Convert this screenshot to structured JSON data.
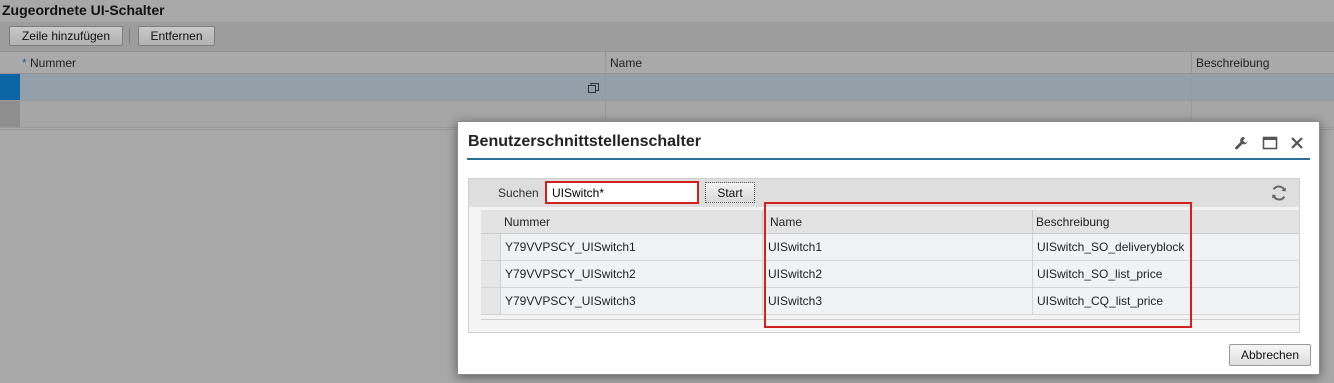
{
  "page": {
    "title": "Zugeordnete UI-Schalter",
    "toolbar": {
      "add_row": "Zeile hinzufügen",
      "remove": "Entfernen"
    },
    "table": {
      "required_marker": "*",
      "columns": [
        "Nummer",
        "Name",
        "Beschreibung"
      ]
    }
  },
  "dialog": {
    "title": "Benutzerschnittstellenschalter",
    "tools": [
      "wrench-icon",
      "maximize-icon",
      "close-icon"
    ],
    "search": {
      "label": "Suchen",
      "value": "UISwitch*",
      "button": "Start"
    },
    "results": {
      "columns": [
        "Nummer",
        "Name",
        "Beschreibung"
      ],
      "rows": [
        {
          "nummer": "Y79VVPSCY_UISwitch1",
          "name": "UISwitch1",
          "beschreibung": "UISwitch_SO_deliveryblock"
        },
        {
          "nummer": "Y79VVPSCY_UISwitch2",
          "name": "UISwitch2",
          "beschreibung": "UISwitch_SO_list_price"
        },
        {
          "nummer": "Y79VVPSCY_UISwitch3",
          "name": "UISwitch3",
          "beschreibung": "UISwitch_CQ_list_price"
        }
      ]
    },
    "cancel": "Abbrechen"
  },
  "colors": {
    "accent": "#0c66a6",
    "highlight": "#d21f1f",
    "rule": "#2a6f97"
  }
}
